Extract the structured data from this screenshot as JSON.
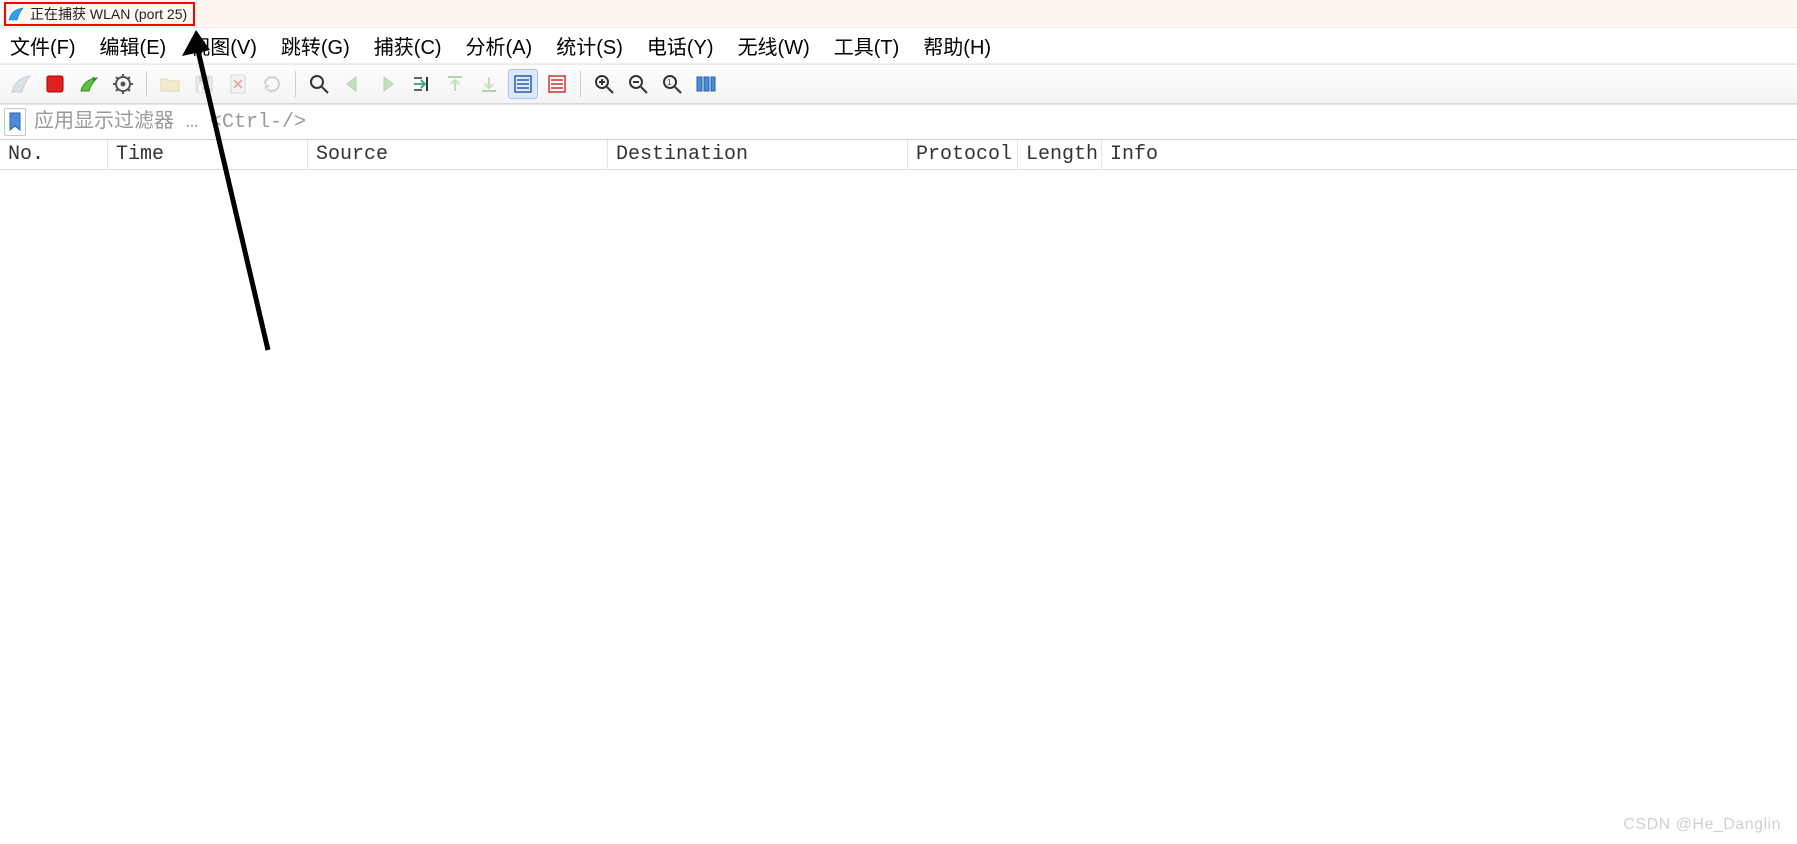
{
  "title": "正在捕获 WLAN (port 25)",
  "menu": {
    "file": "文件(F)",
    "edit": "编辑(E)",
    "view": "视图(V)",
    "go": "跳转(G)",
    "capture": "捕获(C)",
    "analyze": "分析(A)",
    "stats": "统计(S)",
    "tele": "电话(Y)",
    "wireless": "无线(W)",
    "tools": "工具(T)",
    "help": "帮助(H)"
  },
  "filter": {
    "placeholder": "应用显示过滤器 … <Ctrl-/>"
  },
  "columns": {
    "no": "No.",
    "time": "Time",
    "source": "Source",
    "dest": "Destination",
    "proto": "Protocol",
    "length": "Length",
    "info": "Info"
  },
  "watermark": "CSDN @He_Danglin",
  "col_widths": {
    "no": 108,
    "time": 200,
    "source": 300,
    "dest": 300,
    "proto": 110,
    "length": 84
  }
}
